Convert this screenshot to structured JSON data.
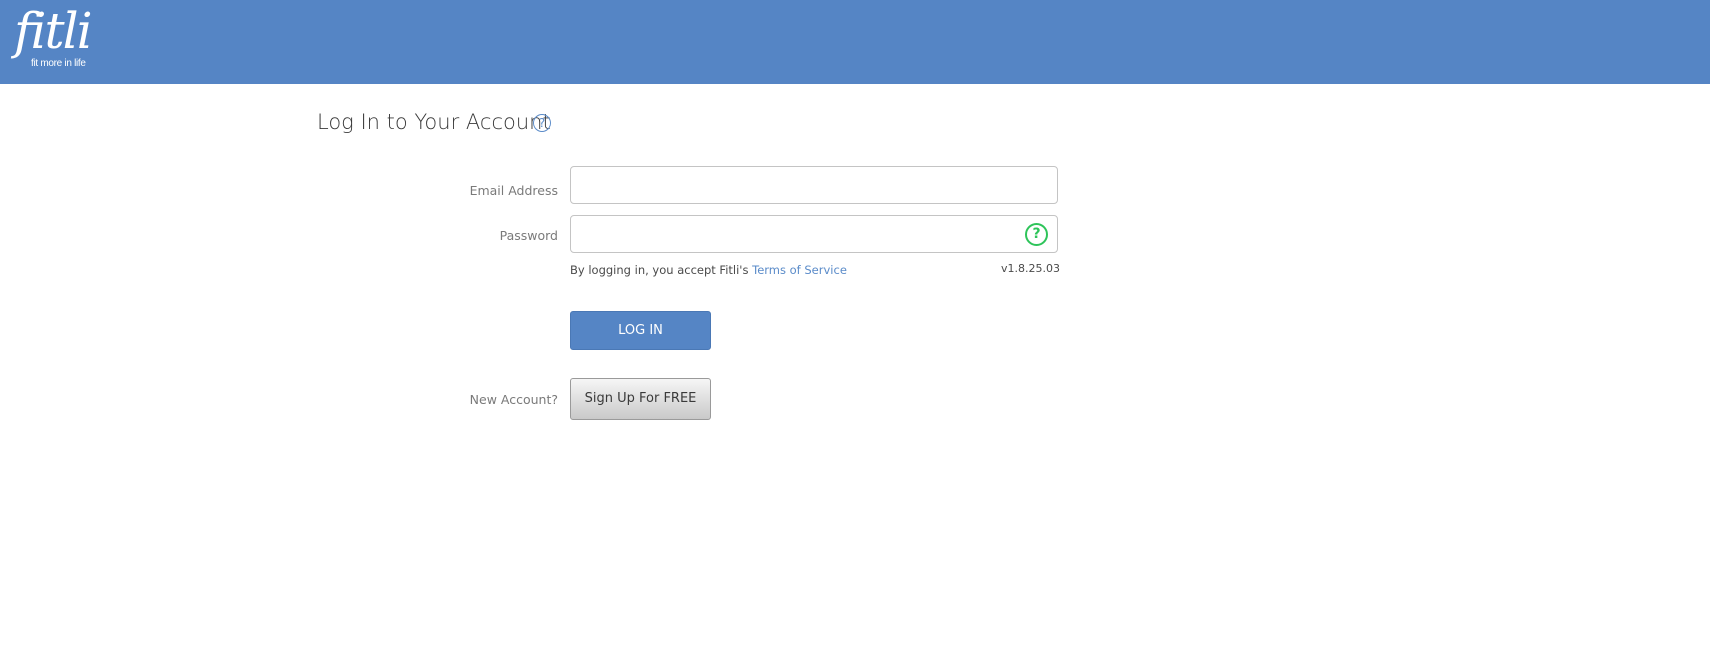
{
  "header": {
    "logo_word": "fitli",
    "logo_tagline": "fit more in life"
  },
  "page": {
    "title": "Log In to Your Account",
    "title_help_glyph": "?"
  },
  "form": {
    "email_label": "Email Address",
    "email_value": "",
    "password_label": "Password",
    "password_value": "",
    "password_help_glyph": "?",
    "terms_prefix": "By logging in, you accept Fitli's ",
    "terms_link": "Terms of Service",
    "version": "v1.8.25.03",
    "login_label": "LOG IN",
    "new_account_label": "New Account?",
    "signup_label": "Sign Up For FREE"
  },
  "icons": {
    "title_help": "question-circle-icon",
    "password_help": "question-circle-icon"
  },
  "colors": {
    "brand_blue": "#5585c5",
    "link_blue": "#5a8bc9",
    "help_green": "#2ec45a"
  }
}
